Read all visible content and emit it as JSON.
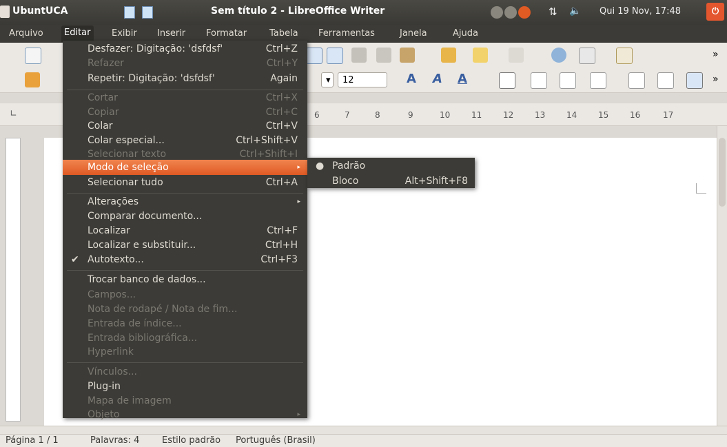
{
  "panel": {
    "app_name": "UbuntUCA",
    "window_title": "Sem título 2 - LibreOffice Writer",
    "clock": "Qui 19 Nov, 17:48",
    "power_symbol": "⏻"
  },
  "menubar": {
    "items": [
      "Arquivo",
      "Editar",
      "Exibir",
      "Inserir",
      "Formatar",
      "Tabela",
      "Ferramentas",
      "Janela",
      "Ajuda"
    ]
  },
  "formatting": {
    "font_size": "12"
  },
  "ruler": {
    "ticks": [
      "6",
      "7",
      "8",
      "9",
      "10",
      "11",
      "12",
      "13",
      "14",
      "15",
      "16",
      "17"
    ]
  },
  "edit_menu": {
    "items": [
      {
        "label": "Desfazer: Digitação: 'dsfdsf'",
        "accel": "Ctrl+Z",
        "enabled": true
      },
      {
        "label": "Refazer",
        "accel": "Ctrl+Y",
        "enabled": false
      },
      {
        "label": "Repetir: Digitação: 'dsfdsf'",
        "accel": "Again",
        "enabled": true
      },
      {
        "label": "Cortar",
        "accel": "Ctrl+X",
        "enabled": false
      },
      {
        "label": "Copiar",
        "accel": "Ctrl+C",
        "enabled": false
      },
      {
        "label": "Colar",
        "accel": "Ctrl+V",
        "enabled": true
      },
      {
        "label": "Colar especial...",
        "accel": "Ctrl+Shift+V",
        "enabled": true
      },
      {
        "label": "Selecionar texto",
        "accel": "Ctrl+Shift+I",
        "enabled": false
      },
      {
        "label": "Modo de seleção",
        "accel": "",
        "enabled": true
      },
      {
        "label": "Selecionar tudo",
        "accel": "Ctrl+A",
        "enabled": true
      },
      {
        "label": "Alterações",
        "accel": "",
        "enabled": true
      },
      {
        "label": "Comparar documento...",
        "accel": "",
        "enabled": true
      },
      {
        "label": "Localizar",
        "accel": "Ctrl+F",
        "enabled": true
      },
      {
        "label": "Localizar e substituir...",
        "accel": "Ctrl+H",
        "enabled": true
      },
      {
        "label": "Autotexto...",
        "accel": "Ctrl+F3",
        "enabled": true
      },
      {
        "label": "Trocar banco de dados...",
        "accel": "",
        "enabled": true
      },
      {
        "label": "Campos...",
        "accel": "",
        "enabled": false
      },
      {
        "label": "Nota de rodapé / Nota de fim...",
        "accel": "",
        "enabled": false
      },
      {
        "label": "Entrada de índice...",
        "accel": "",
        "enabled": false
      },
      {
        "label": "Entrada bibliográfica...",
        "accel": "",
        "enabled": false
      },
      {
        "label": "Hyperlink",
        "accel": "",
        "enabled": false
      },
      {
        "label": "Vínculos...",
        "accel": "",
        "enabled": false
      },
      {
        "label": "Plug-in",
        "accel": "",
        "enabled": true
      },
      {
        "label": "Mapa de imagem",
        "accel": "",
        "enabled": false
      },
      {
        "label": "Objeto",
        "accel": "",
        "enabled": false
      }
    ]
  },
  "selection_submenu": {
    "items": [
      {
        "label": "Padrão",
        "accel": "",
        "checked": true
      },
      {
        "label": "Bloco",
        "accel": "Alt+Shift+F8",
        "checked": false
      }
    ]
  },
  "statusbar": {
    "page": "Página 1 / 1",
    "words": "Palavras: 4",
    "style": "Estilo padrão",
    "language": "Português (Brasil)"
  },
  "colors": {
    "accent": "#e9662f",
    "menu_bg": "#3c3b37",
    "panel_bg": "#3c3b37"
  }
}
